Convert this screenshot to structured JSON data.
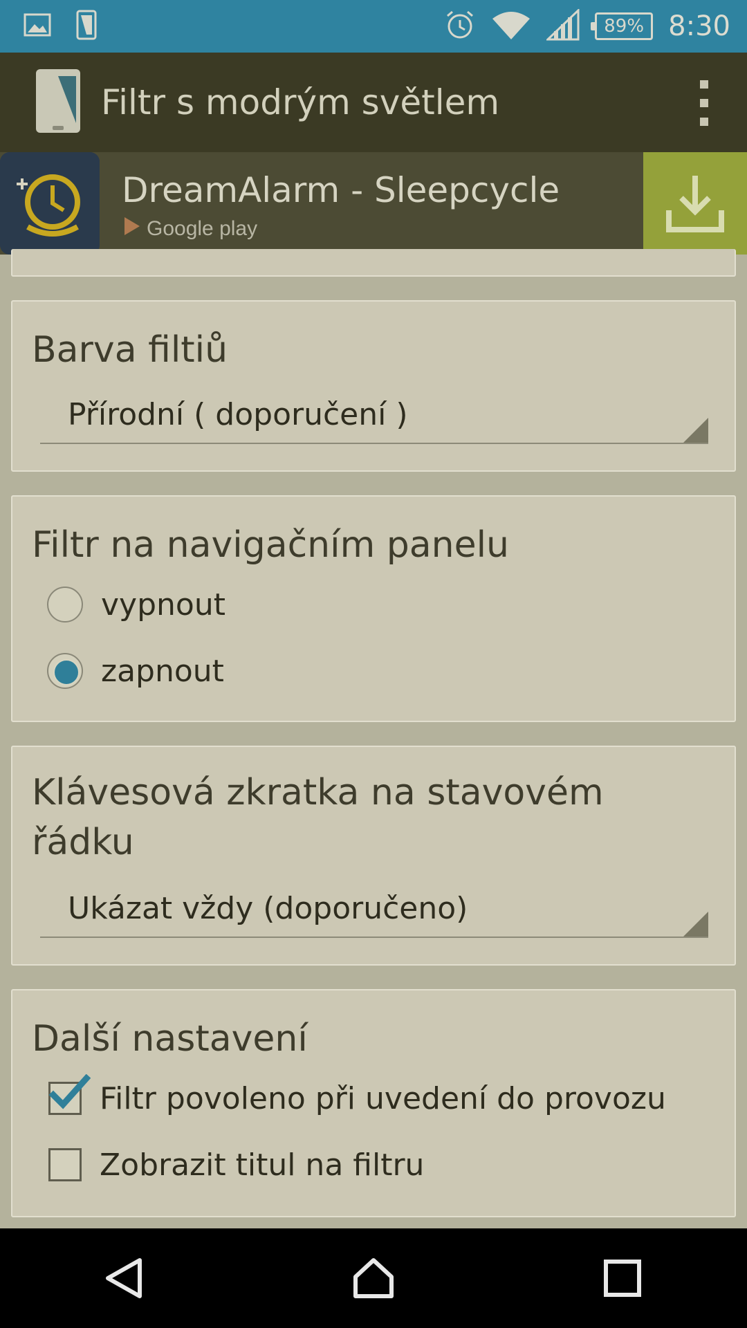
{
  "status_bar": {
    "battery": "89%",
    "time": "8:30",
    "icons": [
      "gallery-icon",
      "phone-icon",
      "alarm-icon",
      "wifi-icon",
      "signal-icon",
      "battery-icon"
    ]
  },
  "action_bar": {
    "title": "Filtr s modrým světlem",
    "menu_icon": "overflow-menu-icon"
  },
  "ad": {
    "title": "DreamAlarm - Sleepcycle",
    "store": "Google play",
    "accent": "#94a13a"
  },
  "filter_color": {
    "title": "Barva filtiů",
    "selected": "Přírodní  ( doporučení )"
  },
  "nav_filter": {
    "title": "Filtr na navigačním panelu",
    "options": [
      {
        "label": "vypnout",
        "checked": false
      },
      {
        "label": "zapnout",
        "checked": true
      }
    ]
  },
  "shortcut": {
    "title": "Klávesová zkratka na stavovém řádku",
    "selected": "Ukázat vždy (doporučeno)"
  },
  "other": {
    "title": "Další nastavení",
    "options": [
      {
        "label": "Filtr povoleno při uvedení do provozu",
        "checked": true
      },
      {
        "label": "Zobrazit titul na filtru",
        "checked": false
      }
    ]
  },
  "colors": {
    "status_bar": "#2f83a0",
    "action_bar": "#3b3a24",
    "card": "#ccc8b4",
    "accent": "#2f7f99"
  }
}
